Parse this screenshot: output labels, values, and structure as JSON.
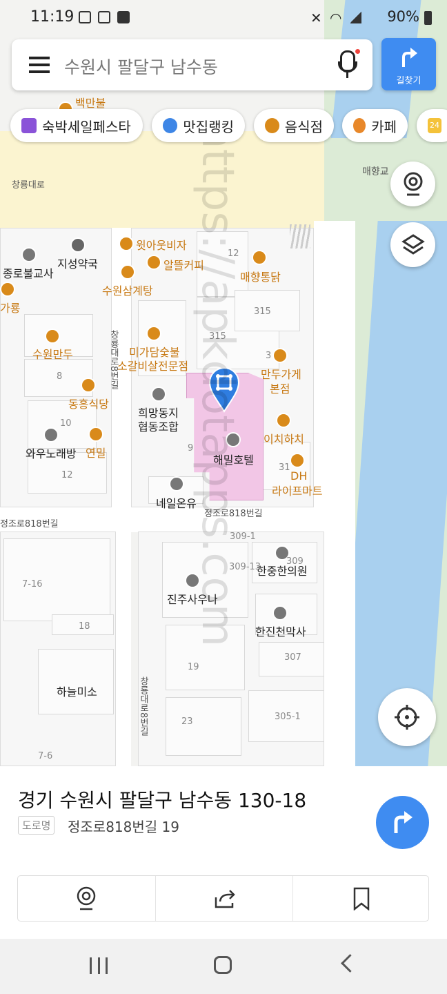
{
  "status": {
    "time": "11:19",
    "battery": "90%"
  },
  "search": {
    "placeholder": "수원시 팔달구 남수동",
    "directions_label": "길찾기"
  },
  "chips": [
    "숙박세일페스타",
    "맛집랭킹",
    "음식점",
    "카페",
    "24"
  ],
  "map": {
    "roads": [
      "창룡대로",
      "매향교",
      "정조로818번길",
      "창룡대로8번길"
    ],
    "pois": [
      {
        "name": "백만불",
        "color": "orange"
      },
      {
        "name": "윗아웃비자",
        "color": "orange"
      },
      {
        "name": "지성약국",
        "color": "black"
      },
      {
        "name": "알뜰커피",
        "color": "orange"
      },
      {
        "name": "종로불교사",
        "color": "black"
      },
      {
        "name": "매향통닭",
        "color": "orange"
      },
      {
        "name": "수원삼계탕",
        "color": "orange"
      },
      {
        "name": "가룡",
        "color": "orange"
      },
      {
        "name": "미가담숯불",
        "color": "orange"
      },
      {
        "name": "소갈비살전문점",
        "color": "orange"
      },
      {
        "name": "수원만두",
        "color": "orange"
      },
      {
        "name": "만두가게",
        "color": "orange"
      },
      {
        "name": "본점",
        "color": "orange"
      },
      {
        "name": "동흥식당",
        "color": "orange"
      },
      {
        "name": "희망동지",
        "color": "black"
      },
      {
        "name": "협동조합",
        "color": "black"
      },
      {
        "name": "이치하치",
        "color": "orange"
      },
      {
        "name": "와우노래방",
        "color": "black"
      },
      {
        "name": "연밀",
        "color": "orange"
      },
      {
        "name": "해밀호텔",
        "color": "black"
      },
      {
        "name": "DH",
        "color": "orange"
      },
      {
        "name": "라이프마트",
        "color": "orange"
      },
      {
        "name": "네일온유",
        "color": "black"
      },
      {
        "name": "한중한의원",
        "color": "black"
      },
      {
        "name": "진주사우나",
        "color": "black"
      },
      {
        "name": "한진천막사",
        "color": "black"
      },
      {
        "name": "하늘미소",
        "color": "black"
      }
    ],
    "numbers": [
      "12",
      "315",
      "315",
      "3",
      "8",
      "10",
      "12",
      "9",
      "31",
      "309-1",
      "309-13",
      "309",
      "7-16",
      "18",
      "19",
      "307",
      "23",
      "305-1",
      "7-6",
      "3"
    ]
  },
  "place": {
    "address": "경기 수원시 팔달구 남수동 130-18",
    "road_tag": "도로명",
    "road_address": "정조로818번길 19"
  },
  "watermark": "https://apkdotapps.com",
  "colors": {
    "accent": "#3f8cf1",
    "river": "#a9d0ef",
    "highlight": "#f2c6e6",
    "poi_orange": "#c77812"
  }
}
